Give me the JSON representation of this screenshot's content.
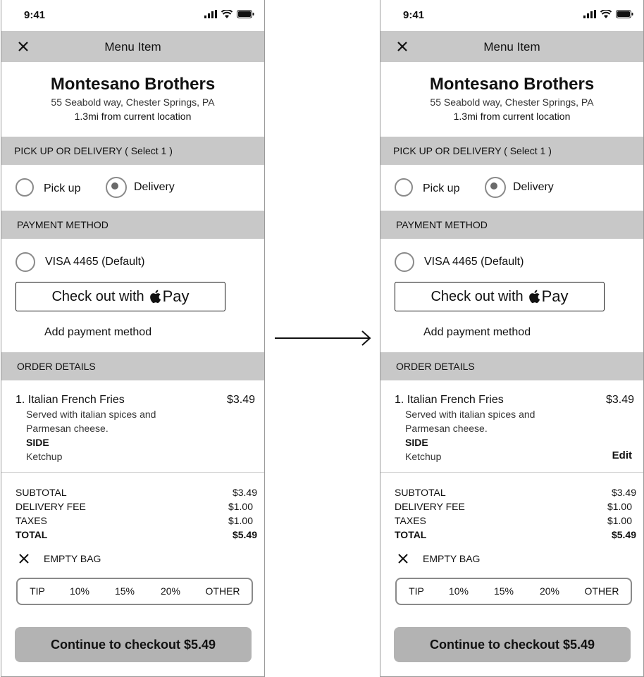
{
  "screens": [
    {
      "status": {
        "time": "9:41"
      },
      "nav": {
        "title": "Menu Item"
      },
      "restaurant": {
        "name": "Montesano Brothers",
        "address": "55 Seabold way, Chester Springs, PA",
        "distance": "1.3mi from current location"
      },
      "fulfillment": {
        "header": "PICK UP OR DELIVERY ( Select 1 )",
        "options": [
          "Pick up",
          "Delivery"
        ],
        "selected": "Delivery"
      },
      "payment": {
        "header": "PAYMENT METHOD",
        "card": "VISA 4465 (Default)",
        "applepay_prefix": "Check out with",
        "applepay_suffix": "Pay",
        "add": "Add payment method"
      },
      "order": {
        "header": "ORDER DETAILS",
        "item": {
          "name": "1. Italian French Fries",
          "price": "$3.49",
          "desc_line1": "Served with italian spices and",
          "desc_line2": "Parmesan cheese.",
          "option_title": "SIDE",
          "option_value": "Ketchup"
        }
      },
      "totals": {
        "subtotal_label": "SUBTOTAL",
        "subtotal": "$3.49",
        "delivery_label": "DELIVERY FEE",
        "delivery": "$1.00",
        "taxes_label": "TAXES",
        "taxes": "$1.00",
        "total_label": "TOTAL",
        "total": "$5.49"
      },
      "empty_bag": "EMPTY BAG",
      "tips": [
        "TIP",
        "10%",
        "15%",
        "20%",
        "OTHER"
      ],
      "checkout": "Continue to checkout $5.49"
    },
    {
      "status": {
        "time": "9:41"
      },
      "nav": {
        "title": "Menu Item"
      },
      "restaurant": {
        "name": "Montesano Brothers",
        "address": "55 Seabold way, Chester Springs, PA",
        "distance": "1.3mi from current location"
      },
      "fulfillment": {
        "header": "PICK UP OR DELIVERY ( Select 1 )",
        "options": [
          "Pick up",
          "Delivery"
        ],
        "selected": "Delivery"
      },
      "payment": {
        "header": "PAYMENT METHOD",
        "card": "VISA 4465 (Default)",
        "applepay_prefix": "Check out with",
        "applepay_suffix": "Pay",
        "add": "Add payment method"
      },
      "order": {
        "header": "ORDER DETAILS",
        "item": {
          "name": "1. Italian French Fries",
          "price": "$3.49",
          "desc_line1": "Served with italian spices and",
          "desc_line2": "Parmesan cheese.",
          "option_title": "SIDE",
          "option_value": "Ketchup",
          "edit": "Edit"
        }
      },
      "totals": {
        "subtotal_label": "SUBTOTAL",
        "subtotal": "$3.49",
        "delivery_label": "DELIVERY FEE",
        "delivery": "$1.00",
        "taxes_label": "TAXES",
        "taxes": "$1.00",
        "total_label": "TOTAL",
        "total": "$5.49"
      },
      "empty_bag": "EMPTY BAG",
      "tips": [
        "TIP",
        "10%",
        "15%",
        "20%",
        "OTHER"
      ],
      "checkout": "Continue to checkout $5.49"
    }
  ],
  "colors": {
    "header_bg": "#c8c8c8",
    "button_bg": "#b3b3b3",
    "radio_border": "#8a8a8a"
  },
  "icons": {
    "close": "close-icon",
    "apple": "apple-logo-icon",
    "signal": "signal-icon",
    "wifi": "wifi-icon",
    "battery": "battery-icon",
    "transition": "arrow-right-icon"
  }
}
